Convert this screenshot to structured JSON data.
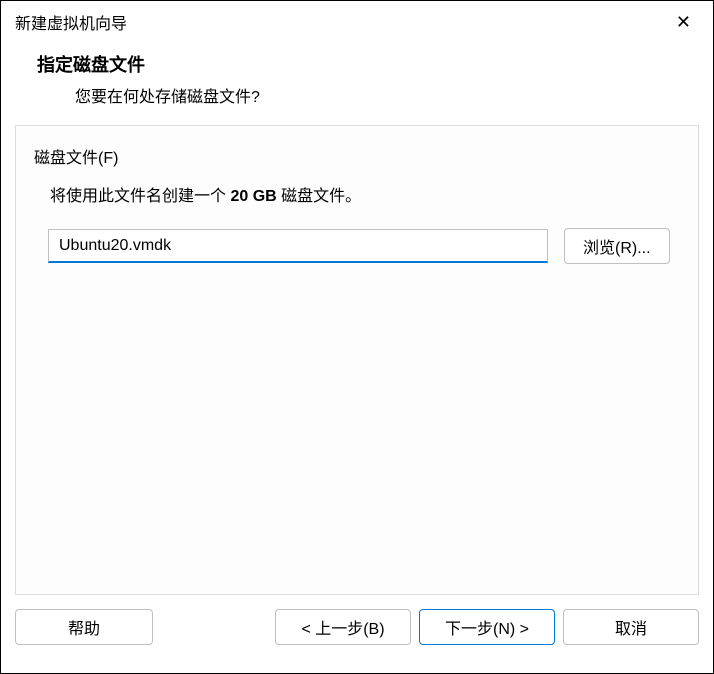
{
  "window": {
    "title": "新建虚拟机向导"
  },
  "header": {
    "title": "指定磁盘文件",
    "subtitle": "您要在何处存储磁盘文件?"
  },
  "content": {
    "section_label": "磁盘文件(F)",
    "desc_prefix": "将使用此文件名创建一个 ",
    "desc_bold": "20 GB",
    "desc_suffix": " 磁盘文件。",
    "file_value": "Ubuntu20.vmdk",
    "browse_label": "浏览(R)..."
  },
  "footer": {
    "help_label": "帮助",
    "back_label": "< 上一步(B)",
    "next_label": "下一步(N) >",
    "cancel_label": "取消"
  }
}
